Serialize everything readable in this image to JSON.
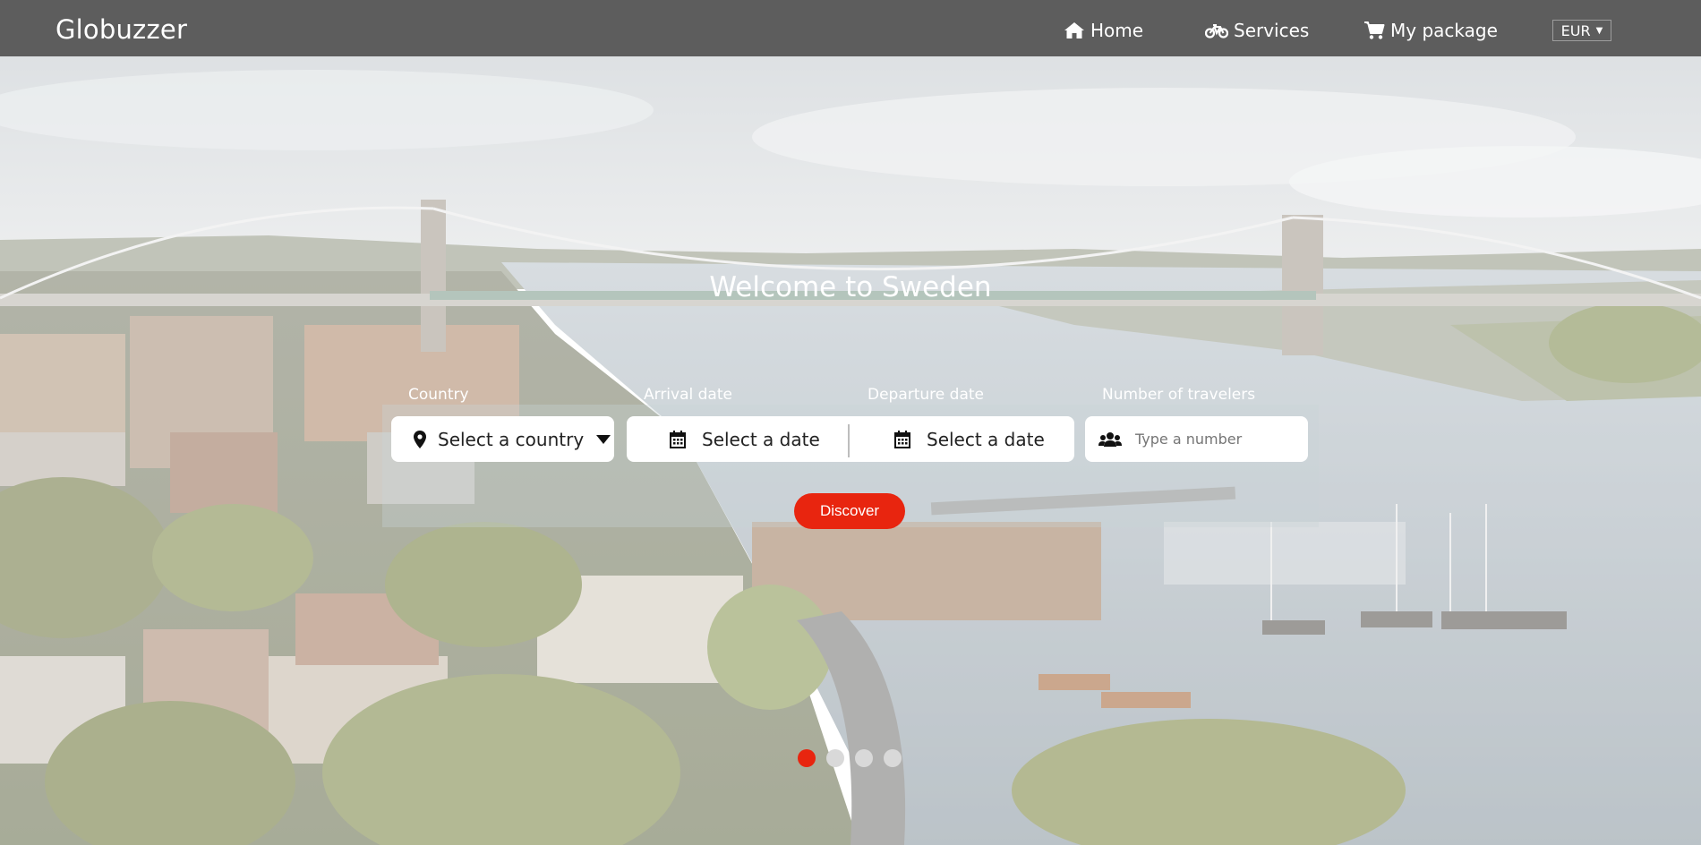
{
  "brand": "Globuzzer",
  "nav": {
    "home": "Home",
    "services": "Services",
    "package": "My package",
    "currency": "EUR"
  },
  "hero": {
    "title": "Welcome to Sweden"
  },
  "search": {
    "country_label": "Country",
    "country_value": "Select a country",
    "arrival_label": "Arrival date",
    "arrival_value": "Select a date",
    "departure_label": "Departure date",
    "departure_value": "Select a date",
    "travelers_label": "Number of travelers",
    "travelers_placeholder": "Type a number",
    "discover_label": "Discover"
  },
  "carousel": {
    "slides": 4,
    "active": 1
  },
  "colors": {
    "nav_bg": "#5d5d5d",
    "accent": "#e8250f"
  },
  "icons": [
    "home-icon",
    "bicycle-icon",
    "cart-icon",
    "map-marker-icon",
    "caret-down-icon",
    "calendar-icon",
    "users-icon"
  ]
}
